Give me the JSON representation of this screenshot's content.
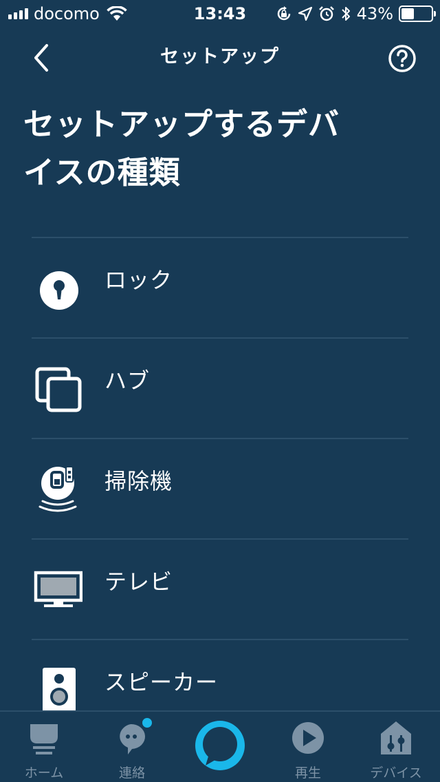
{
  "status_bar": {
    "carrier": "docomo",
    "time": "13:43",
    "battery_percent": "43%",
    "battery_level": 0.43,
    "icons": [
      "signal-icon",
      "wifi-icon",
      "rotation-lock-icon",
      "location-icon",
      "alarm-icon",
      "bluetooth-icon",
      "battery-icon"
    ]
  },
  "nav": {
    "title": "セットアップ",
    "back_icon": "chevron-left-icon",
    "help_icon": "help-icon"
  },
  "page": {
    "title_line1": "セットアップするデバ",
    "title_line2": "イスの種類"
  },
  "device_types": [
    {
      "label": "ロック",
      "icon": "lock-icon"
    },
    {
      "label": "ハブ",
      "icon": "hub-icon"
    },
    {
      "label": "掃除機",
      "icon": "vacuum-icon"
    },
    {
      "label": "テレビ",
      "icon": "tv-icon"
    },
    {
      "label": "スピーカー",
      "icon": "speaker-icon"
    }
  ],
  "tab_bar": {
    "tabs": [
      {
        "label": "ホーム",
        "icon": "home-icon"
      },
      {
        "label": "連絡",
        "icon": "communicate-icon"
      },
      {
        "label": "",
        "icon": "alexa-icon"
      },
      {
        "label": "再生",
        "icon": "play-icon"
      },
      {
        "label": "デバイス",
        "icon": "devices-icon"
      }
    ]
  },
  "colors": {
    "background": "#173a55",
    "divider": "#2c4f6a",
    "tab_inactive": "#7d93a6",
    "alexa_accent": "#1ab7ea",
    "text": "#ffffff"
  }
}
